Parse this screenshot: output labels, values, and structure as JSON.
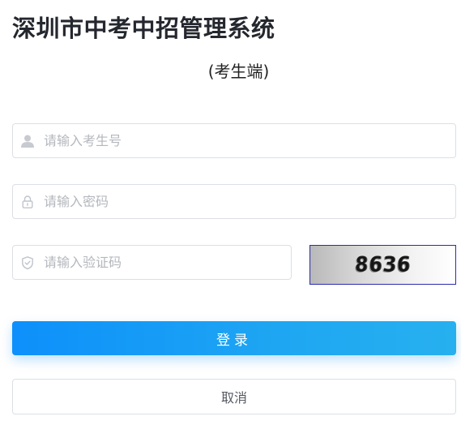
{
  "header": {
    "title": "深圳市中考中招管理系统",
    "subtitle": "(考生端)"
  },
  "form": {
    "candidate_number": {
      "icon": "user-icon",
      "placeholder": "请输入考生号",
      "value": ""
    },
    "password": {
      "icon": "lock-icon",
      "placeholder": "请输入密码",
      "value": ""
    },
    "verification_code": {
      "icon": "shield-icon",
      "placeholder": "请输入验证码",
      "value": ""
    },
    "captcha_text": "8636"
  },
  "actions": {
    "login_label": "登录",
    "cancel_label": "取消"
  },
  "colors": {
    "primary_start": "#0d90fb",
    "primary_end": "#27b0ef",
    "border": "#dcdfe6",
    "placeholder": "#b4b7bd",
    "title": "#24272e"
  }
}
